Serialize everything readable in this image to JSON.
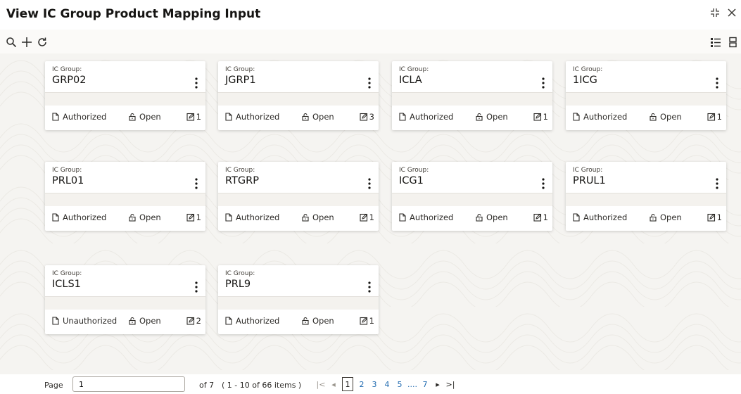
{
  "window": {
    "title": "View IC Group Product Mapping Input",
    "controls": [
      "minimize-icon",
      "close-icon"
    ]
  },
  "toolbar": {
    "left": [
      "search-icon",
      "add-icon",
      "refresh-icon"
    ],
    "right": [
      "list-view-icon",
      "tile-view-icon"
    ]
  },
  "records": [
    {
      "label": "IC Group:",
      "value": "GRP02",
      "status": "Authorized",
      "lock": "Open",
      "mods": "1"
    },
    {
      "label": "IC Group:",
      "value": "JGRP1",
      "status": "Authorized",
      "lock": "Open",
      "mods": "3"
    },
    {
      "label": "IC Group:",
      "value": "ICLA",
      "status": "Authorized",
      "lock": "Open",
      "mods": "1"
    },
    {
      "label": "IC Group:",
      "value": "1ICG",
      "status": "Authorized",
      "lock": "Open",
      "mods": "1"
    },
    {
      "label": "IC Group:",
      "value": "PRL01",
      "status": "Authorized",
      "lock": "Open",
      "mods": "1"
    },
    {
      "label": "IC Group:",
      "value": "RTGRP",
      "status": "Authorized",
      "lock": "Open",
      "mods": "1"
    },
    {
      "label": "IC Group:",
      "value": "ICG1",
      "status": "Authorized",
      "lock": "Open",
      "mods": "1"
    },
    {
      "label": "IC Group:",
      "value": "PRUL1",
      "status": "Authorized",
      "lock": "Open",
      "mods": "1"
    },
    {
      "label": "IC Group:",
      "value": "ICLS1",
      "status": "Unauthorized",
      "lock": "Open",
      "mods": "2"
    },
    {
      "label": "IC Group:",
      "value": "PRL9",
      "status": "Authorized",
      "lock": "Open",
      "mods": "1"
    }
  ],
  "pagination": {
    "page_label": "Page",
    "page_value": "1",
    "of_text": "of 7",
    "range_text": "( 1 - 10 of 66 items )",
    "first": "|<",
    "prev": "◂",
    "current": "1",
    "pages": [
      "2",
      "3",
      "4",
      "5"
    ],
    "ellipsis": "....",
    "last_page": "7",
    "next": "▸",
    "last": ">|"
  }
}
